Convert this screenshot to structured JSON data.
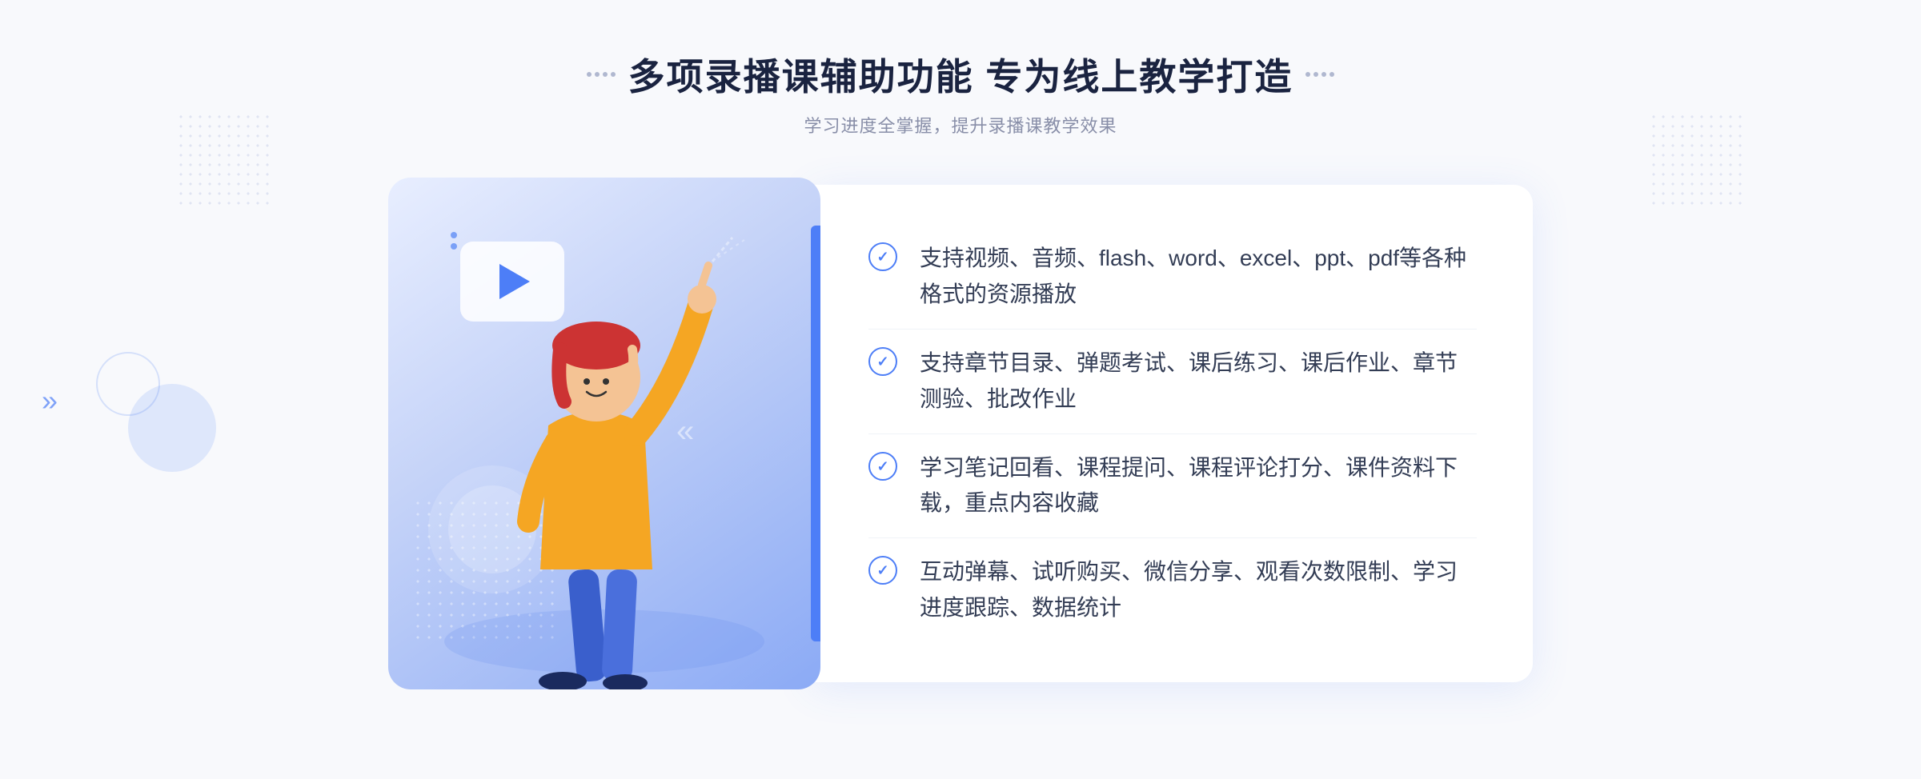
{
  "page": {
    "background_color": "#f8f9fc"
  },
  "header": {
    "dots_label": "decorative dots",
    "title": "多项录播课辅助功能 专为线上教学打造",
    "subtitle": "学习进度全掌握，提升录播课教学效果"
  },
  "features": [
    {
      "id": 1,
      "text": "支持视频、音频、flash、word、excel、ppt、pdf等各种格式的资源播放"
    },
    {
      "id": 2,
      "text": "支持章节目录、弹题考试、课后练习、课后作业、章节测验、批改作业"
    },
    {
      "id": 3,
      "text": "学习笔记回看、课程提问、课程评论打分、课件资料下载，重点内容收藏"
    },
    {
      "id": 4,
      "text": "互动弹幕、试听购买、微信分享、观看次数限制、学习进度跟踪、数据统计"
    }
  ],
  "decorative": {
    "chevron_left": "»",
    "play_button": "▶"
  }
}
